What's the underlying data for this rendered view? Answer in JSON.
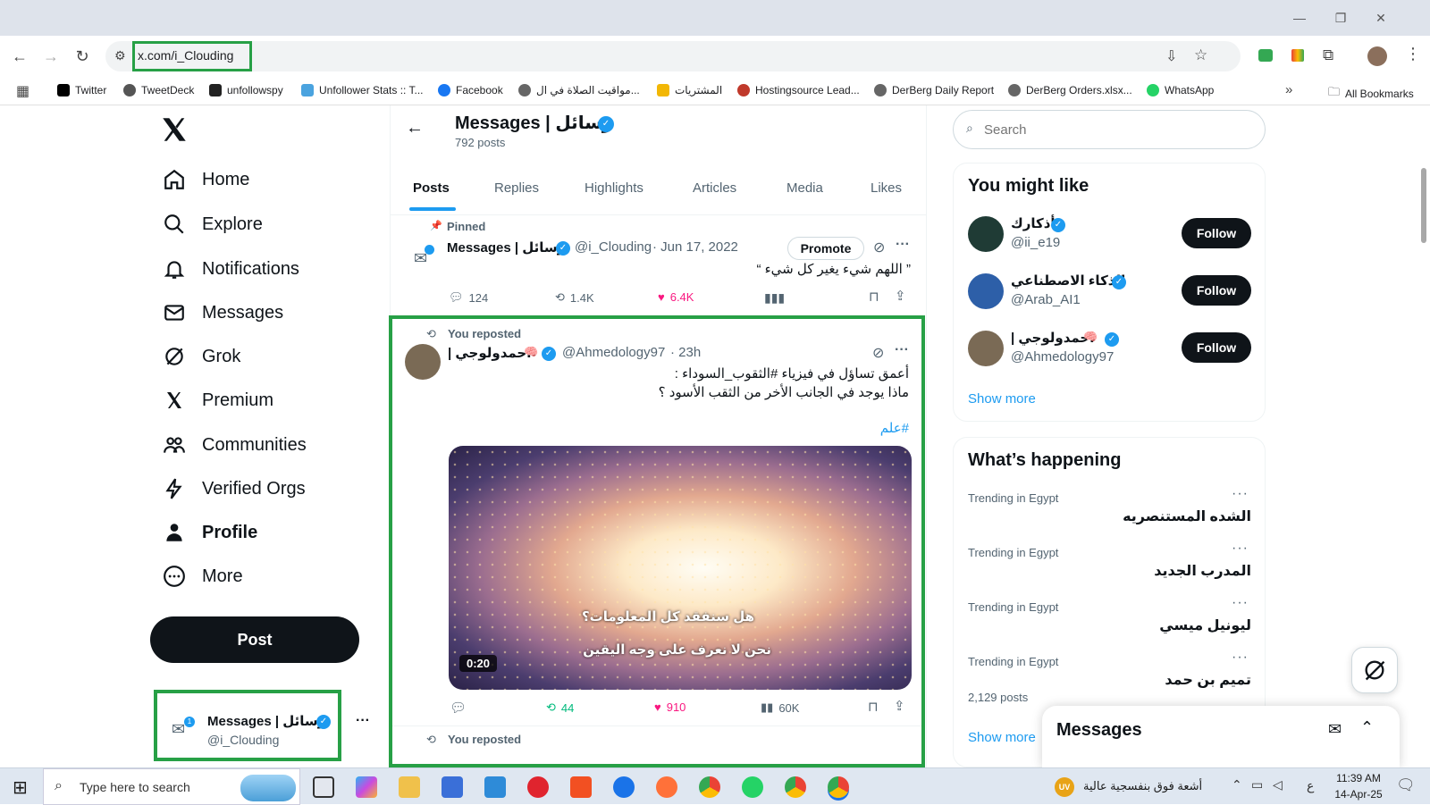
{
  "browser": {
    "url": "x.com/i_Clouding",
    "bookmarks": [
      {
        "label": "Twitter",
        "color": "#000000"
      },
      {
        "label": "TweetDeck",
        "color": "#555555"
      },
      {
        "label": "unfollowspy",
        "color": "#222222"
      },
      {
        "label": "Unfollower Stats :: T...",
        "color": "#4aa3df"
      },
      {
        "label": "Facebook",
        "color": "#1877f2"
      },
      {
        "label": "مواقيت الصلاة في ال...",
        "color": "#666666"
      },
      {
        "label": "المشتريات",
        "color": "#f2b705"
      },
      {
        "label": "Hostingsource Lead...",
        "color": "#c0392b"
      },
      {
        "label": "DerBerg Daily Report",
        "color": "#666666"
      },
      {
        "label": "DerBerg Orders.xlsx...",
        "color": "#666666"
      },
      {
        "label": "WhatsApp",
        "color": "#25d366"
      }
    ],
    "all_bookmarks": "All Bookmarks"
  },
  "sidebar": {
    "items": [
      {
        "label": "Home",
        "icon": "home-icon"
      },
      {
        "label": "Explore",
        "icon": "search-icon"
      },
      {
        "label": "Notifications",
        "icon": "bell-icon"
      },
      {
        "label": "Messages",
        "icon": "mail-icon"
      },
      {
        "label": "Grok",
        "icon": "grok-icon"
      },
      {
        "label": "Premium",
        "icon": "x-icon"
      },
      {
        "label": "Communities",
        "icon": "people-icon"
      },
      {
        "label": "Verified Orgs",
        "icon": "bolt-icon"
      },
      {
        "label": "Profile",
        "icon": "person-icon"
      },
      {
        "label": "More",
        "icon": "more-icon"
      }
    ],
    "post_label": "Post",
    "account": {
      "name": "Messages | رسائل",
      "handle": "@i_Clouding",
      "badge": "1"
    }
  },
  "profile_header": {
    "name": "Messages | رسائل",
    "posts_count": "792 posts"
  },
  "tabs": [
    "Posts",
    "Replies",
    "Highlights",
    "Articles",
    "Media",
    "Likes"
  ],
  "pinned_post": {
    "pinned_label": "Pinned",
    "name": "Messages | رسائل",
    "handle": "@i_Clouding",
    "date": "· Jun 17, 2022",
    "promote": "Promote",
    "text": "” اللهم شيء يغير كل شيء “",
    "replies": "124",
    "reposts": "1.4K",
    "likes": "6.4K"
  },
  "repost": {
    "label": "You reposted",
    "name": "احمدولوجي |",
    "handle": "@Ahmedology97",
    "time": "· 23h",
    "line1": "أعمق تساؤل في فيزياء #الثقوب_السوداء :",
    "line2": "ماذا يوجد في الجانب الأخر من الثقب الأسود ؟",
    "hashtag": "#علم",
    "video_caption1": "هل سنفقد كل المعلومات؟",
    "video_caption2": "نحن لا نعرف على وجه اليقين",
    "duration": "0:20",
    "reposts": "44",
    "likes": "910",
    "views": "60K"
  },
  "next_repost_label": "You reposted",
  "search": {
    "placeholder": "Search"
  },
  "suggestions": {
    "title": "You might like",
    "follow": "Follow",
    "users": [
      {
        "name": "أذكارك",
        "handle": "@ii_e19",
        "avatar_color": "#1f3b35"
      },
      {
        "name": "الذكاء الاصطناعي",
        "handle": "@Arab_AI1",
        "avatar_color": "#2d5fa8"
      },
      {
        "name": "احمدولوجي |",
        "handle": "@Ahmedology97",
        "avatar_color": "#7a6a55"
      }
    ],
    "show_more": "Show more"
  },
  "happening": {
    "title": "What’s happening",
    "trends": [
      {
        "meta": "Trending in Egypt",
        "title": "الشده المستنصريه",
        "posts": ""
      },
      {
        "meta": "Trending in Egypt",
        "title": "المدرب الجديد",
        "posts": ""
      },
      {
        "meta": "Trending in Egypt",
        "title": "ليونيل ميسي",
        "posts": ""
      },
      {
        "meta": "Trending in Egypt",
        "title": "تميم بن حمد",
        "posts": "2,129 posts"
      }
    ],
    "show_more": "Show more"
  },
  "messages_drawer": {
    "title": "Messages"
  },
  "taskbar": {
    "search_placeholder": "Type here to search",
    "weather": "أشعة فوق بنفسجية عالية",
    "weather_badge": "UV",
    "lang": "ع",
    "time": "11:39 AM",
    "date": "14-Apr-25"
  }
}
